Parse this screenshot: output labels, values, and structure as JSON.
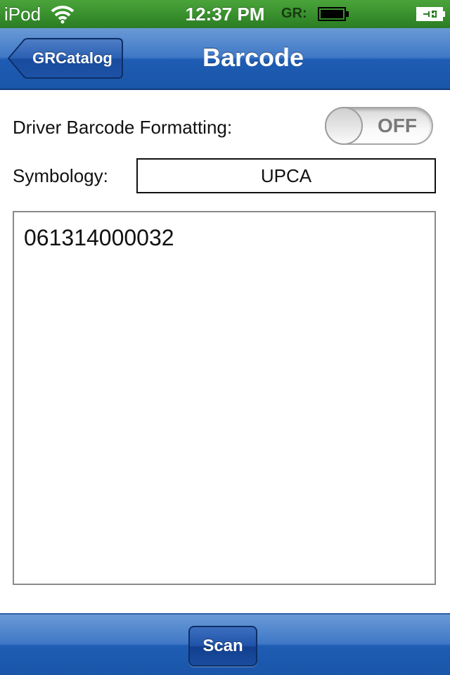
{
  "status_bar": {
    "carrier": "iPod",
    "time": "12:37 PM",
    "gr_label": "GR:",
    "icons": [
      "wifi-icon",
      "gr-battery-icon",
      "device-battery-icon"
    ]
  },
  "nav_bar": {
    "back_label": "GRCatalog",
    "title": "Barcode"
  },
  "form": {
    "formatting_label": "Driver Barcode Formatting:",
    "formatting_toggle": "OFF",
    "symbology_label": "Symbology:",
    "symbology_value": "UPCA",
    "barcode_text": "061314000032"
  },
  "toolbar": {
    "scan_label": "Scan"
  },
  "colors": {
    "status_bar": "#2a7d22",
    "nav_bar": "#1e5db4",
    "toggle_text": "#7a7a7a"
  }
}
